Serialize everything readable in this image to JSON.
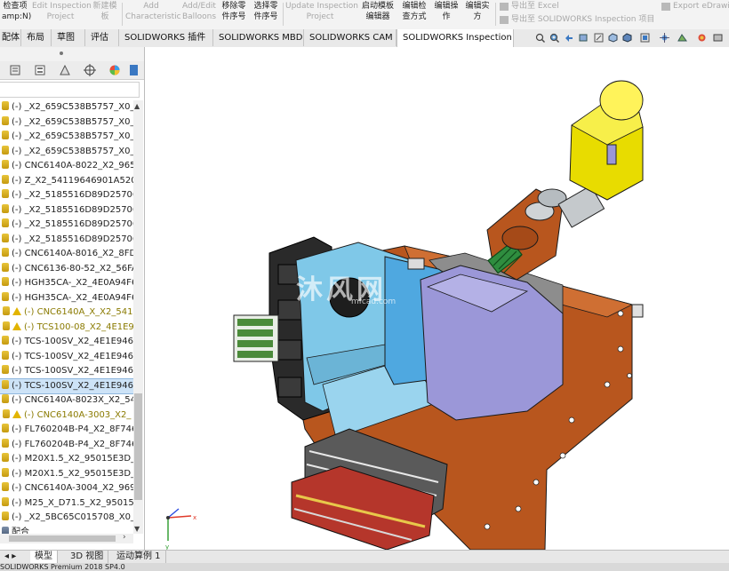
{
  "ribbon": {
    "buttons": [
      {
        "label": "检查项\namp:N)",
        "dim": false
      },
      {
        "label": "Edit Inspection\nProject",
        "dim": true
      },
      {
        "label": "新建模\n板",
        "dim": true
      },
      {
        "label": "Add\nCharacteristic",
        "dim": true
      },
      {
        "label": "Add/Edit\nBalloons",
        "dim": true
      },
      {
        "label": "移除零\n件序号",
        "dim": false
      },
      {
        "label": "选择零\n件序号",
        "dim": false
      },
      {
        "label": "Update Inspection\nProject",
        "dim": true
      },
      {
        "label": "启动模板\n编辑器",
        "dim": false
      },
      {
        "label": "编辑检\n查方式",
        "dim": false
      },
      {
        "label": "编辑操\n作",
        "dim": false
      },
      {
        "label": "编辑实\n方",
        "dim": false
      }
    ],
    "export_excel": "导出至 Excel",
    "export_project": "导出至 SOLIDWORKS Inspection 项目",
    "export_edrawings": "Export eDrawi"
  },
  "command_tabs": [
    {
      "label": "配体",
      "active": false
    },
    {
      "label": "布局",
      "active": false
    },
    {
      "label": "草图",
      "active": false
    },
    {
      "label": "评估",
      "active": false
    },
    {
      "label": "SOLIDWORKS 插件",
      "active": false
    },
    {
      "label": "SOLIDWORKS MBD",
      "active": false
    },
    {
      "label": "SOLIDWORKS CAM",
      "active": false
    },
    {
      "label": "SOLIDWORKS Inspection",
      "active": true
    }
  ],
  "tree": {
    "rows": [
      {
        "icon": "gear",
        "text": "(-) _X2_659C538B5757_X0_(",
        "state": "normal"
      },
      {
        "icon": "gear",
        "text": "(-) _X2_659C538B5757_X0_(",
        "state": "normal"
      },
      {
        "icon": "gear",
        "text": "(-) _X2_659C538B5757_X0_(",
        "state": "normal"
      },
      {
        "icon": "gear",
        "text": "(-) _X2_659C538B5757_X0_(",
        "state": "normal"
      },
      {
        "icon": "gear",
        "text": "(-) CNC6140A-8022_X2_965",
        "state": "normal"
      },
      {
        "icon": "gear",
        "text": "(-) Z_X2_54119646901A520",
        "state": "normal"
      },
      {
        "icon": "gear",
        "text": "(-) _X2_5185516D89D25706",
        "state": "normal"
      },
      {
        "icon": "gear",
        "text": "(-) _X2_5185516D89D25706",
        "state": "normal"
      },
      {
        "icon": "gear",
        "text": "(-) _X2_5185516D89D25706",
        "state": "normal"
      },
      {
        "icon": "gear",
        "text": "(-) _X2_5185516D89D25706",
        "state": "normal"
      },
      {
        "icon": "gear",
        "text": "(-) CNC6140A-8016_X2_8FD",
        "state": "normal"
      },
      {
        "icon": "gear",
        "text": "(-) CNC6136-80-52_X2_56FA",
        "state": "normal"
      },
      {
        "icon": "gear",
        "text": "(-) HGH35CA-_X2_4E0A94F6",
        "state": "normal"
      },
      {
        "icon": "gear",
        "text": "(-) HGH35CA-_X2_4E0A94F6",
        "state": "normal"
      },
      {
        "icon": "warn",
        "text": "(-) CNC6140A_X_X2_541",
        "state": "warn"
      },
      {
        "icon": "warn",
        "text": "(-) TCS100-08_X2_4E1E9",
        "state": "warn"
      },
      {
        "icon": "gear",
        "text": "(-) TCS-100SV_X2_4E1E946E",
        "state": "normal"
      },
      {
        "icon": "gear",
        "text": "(-) TCS-100SV_X2_4E1E946E",
        "state": "normal"
      },
      {
        "icon": "gear",
        "text": "(-) TCS-100SV_X2_4E1E946E",
        "state": "normal"
      },
      {
        "icon": "gear",
        "text": "(-) TCS-100SV_X2_4E1E946E",
        "state": "selected"
      },
      {
        "icon": "gear",
        "text": "(-) CNC6140A-8023X_X2_54",
        "state": "normal"
      },
      {
        "icon": "warn",
        "text": "(-) CNC6140A-3003_X2_",
        "state": "warn"
      },
      {
        "icon": "gear",
        "text": "(-) FL760204B-P4_X2_8F746",
        "state": "normal"
      },
      {
        "icon": "gear",
        "text": "(-) FL760204B-P4_X2_8F746",
        "state": "normal"
      },
      {
        "icon": "gear",
        "text": "(-) M20X1.5_X2_95015E3D_",
        "state": "normal"
      },
      {
        "icon": "gear",
        "text": "(-) M20X1.5_X2_95015E3D_",
        "state": "normal"
      },
      {
        "icon": "gear",
        "text": "(-) CNC6140A-3004_X2_969",
        "state": "normal"
      },
      {
        "icon": "gear",
        "text": "(-) M25_X_D71.5_X2_95015",
        "state": "normal"
      },
      {
        "icon": "gear",
        "text": "(-) _X2_5BC65C015708_X0_",
        "state": "normal"
      },
      {
        "icon": "mate",
        "text": "配合",
        "state": "normal"
      }
    ]
  },
  "bottom_tabs": [
    {
      "label": "模型",
      "active": true
    },
    {
      "label": "3D 视图",
      "active": false
    },
    {
      "label": "运动算例 1",
      "active": false
    }
  ],
  "status": "SOLIDWORKS Premium 2018 SP4.0",
  "watermark": {
    "text": "沐风网",
    "sub": "mfcad.com"
  },
  "colors": {
    "housing_blue": "#7fc8e8",
    "cover_purple": "#9b97d8",
    "motor_yellow": "#f2e800",
    "base_brown": "#b8561e",
    "rail_gray": "#9a9a9a",
    "turret_black": "#2a2a2a"
  }
}
